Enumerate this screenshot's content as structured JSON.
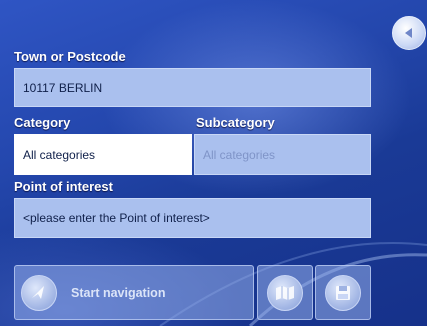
{
  "town": {
    "label": "Town or Postcode",
    "value": "10117 BERLIN"
  },
  "category": {
    "label": "Category",
    "value": "All categories"
  },
  "subcategory": {
    "label": "Subcategory",
    "value": "All categories"
  },
  "poi": {
    "label": "Point of interest",
    "value": "<please enter the Point of interest>"
  },
  "actions": {
    "start_navigation_label": "Start navigation"
  },
  "icons": {
    "back": "back-arrow-icon",
    "start_navigation": "navigation-arrow-icon",
    "map": "map-icon",
    "save": "floppy-disk-icon"
  },
  "colors": {
    "field_bg": "#aac0ee",
    "active_field_bg": "#ffffff",
    "background": "#1e3f9e"
  }
}
